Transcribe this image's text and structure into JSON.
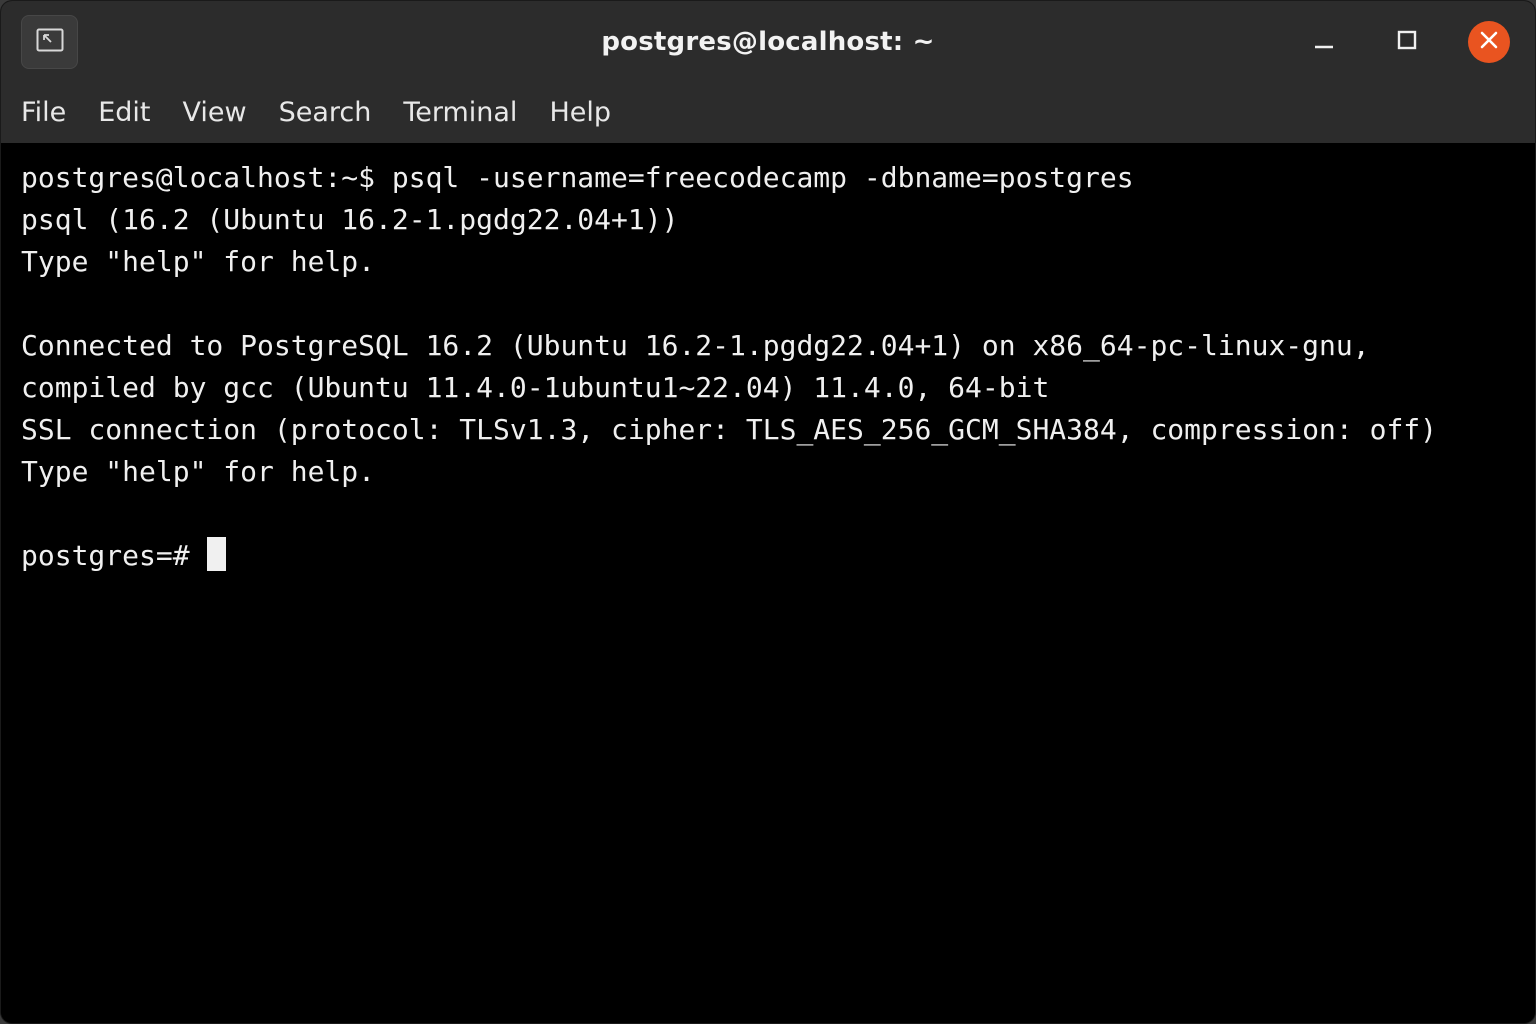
{
  "window": {
    "title": "postgres@localhost: ~"
  },
  "menu": {
    "items": [
      "File",
      "Edit",
      "View",
      "Search",
      "Terminal",
      "Help"
    ]
  },
  "terminal": {
    "lines": [
      "postgres@localhost:~$ psql -username=freecodecamp -dbname=postgres",
      "psql (16.2 (Ubuntu 16.2-1.pgdg22.04+1))",
      "Type \"help\" for help.",
      "",
      "Connected to PostgreSQL 16.2 (Ubuntu 16.2-1.pgdg22.04+1) on x86_64-pc-linux-gnu,",
      "compiled by gcc (Ubuntu 11.4.0-1ubuntu1~22.04) 11.4.0, 64-bit",
      "SSL connection (protocol: TLSv1.3, cipher: TLS_AES_256_GCM_SHA384, compression: off)",
      "Type \"help\" for help.",
      ""
    ],
    "prompt": "postgres=#"
  },
  "icons": {
    "left_button": "new-tab-icon",
    "minimize": "minimize-icon",
    "maximize": "maximize-icon",
    "close": "close-icon"
  },
  "colors": {
    "accent": "#e95420",
    "titlebar": "#2c2c2c",
    "terminal_bg": "#000000",
    "terminal_fg": "#f0f0f0"
  }
}
